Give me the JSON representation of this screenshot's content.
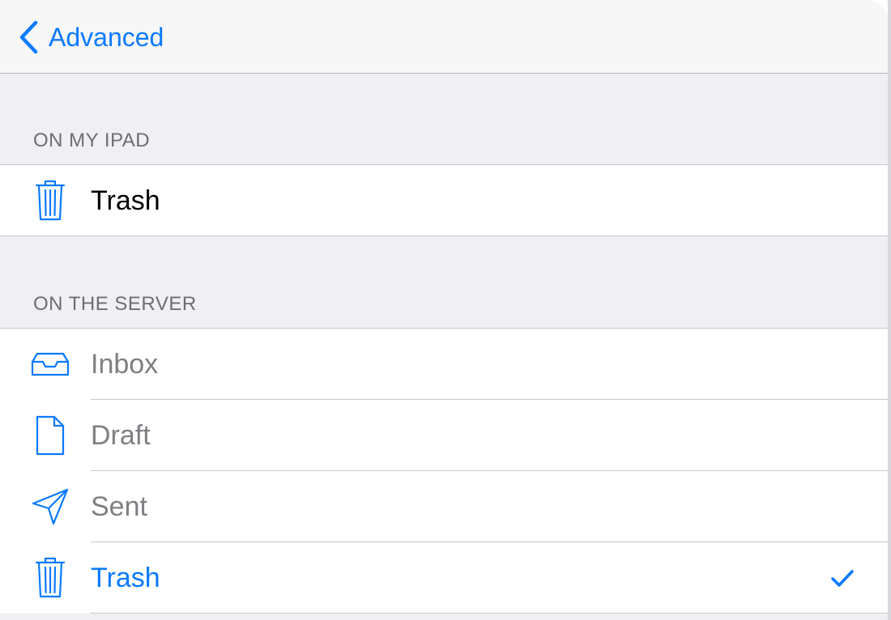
{
  "navbar": {
    "back_label": "Advanced"
  },
  "sections": {
    "on_my_ipad": {
      "header": "ON MY IPAD",
      "items": [
        {
          "label": "Trash",
          "icon": "trash-icon"
        }
      ]
    },
    "on_the_server": {
      "header": "ON THE SERVER",
      "items": [
        {
          "label": "Inbox",
          "icon": "inbox-tray-icon"
        },
        {
          "label": "Draft",
          "icon": "document-icon"
        },
        {
          "label": "Sent",
          "icon": "paper-plane-icon"
        },
        {
          "label": "Trash",
          "icon": "trash-icon",
          "selected": true
        }
      ]
    }
  },
  "colors": {
    "accent": "#0a7aff",
    "background": "#efeff4",
    "separator": "#c8c7cc",
    "header_text": "#6d6d72",
    "disabled_text": "#7f7f84"
  }
}
